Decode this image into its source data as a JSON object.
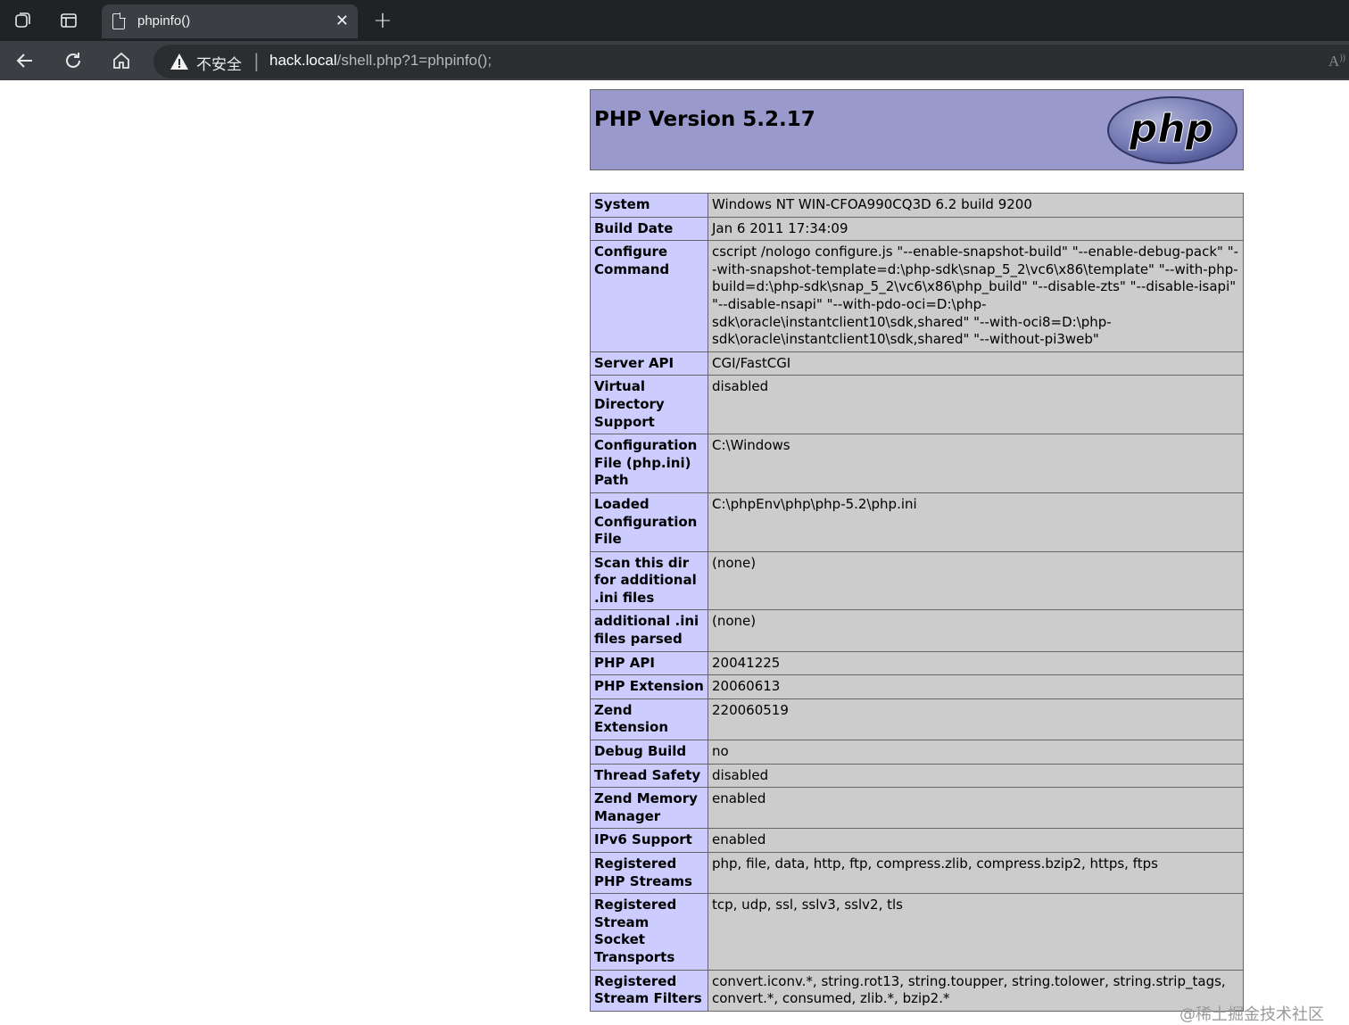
{
  "browser": {
    "tab_title": "phpinfo()",
    "security_label": "不安全",
    "url_host": "hack.local",
    "url_path": "/shell.php?1=phpinfo();",
    "icons": {
      "workspaces": "workspaces-icon",
      "tab_actions": "tab-actions-icon",
      "page": "page-icon",
      "close": "close-icon",
      "new_tab": "plus-icon",
      "back": "back-arrow-icon",
      "refresh": "refresh-icon",
      "home": "home-icon",
      "warning": "warning-icon",
      "read_aloud": "read-aloud-icon"
    }
  },
  "php": {
    "version_title": "PHP Version 5.2.17",
    "logo_text": "php",
    "rows": [
      {
        "key": "System",
        "value": "Windows NT WIN-CFOA990CQ3D 6.2 build 9200"
      },
      {
        "key": "Build Date",
        "value": "Jan 6 2011 17:34:09"
      },
      {
        "key": "Configure Command",
        "value": "cscript /nologo configure.js \"--enable-snapshot-build\" \"--enable-debug-pack\" \"--with-snapshot-template=d:\\php-sdk\\snap_5_2\\vc6\\x86\\template\" \"--with-php-build=d:\\php-sdk\\snap_5_2\\vc6\\x86\\php_build\" \"--disable-zts\" \"--disable-isapi\" \"--disable-nsapi\" \"--with-pdo-oci=D:\\php-sdk\\oracle\\instantclient10\\sdk,shared\" \"--with-oci8=D:\\php-sdk\\oracle\\instantclient10\\sdk,shared\" \"--without-pi3web\""
      },
      {
        "key": "Server API",
        "value": "CGI/FastCGI"
      },
      {
        "key": "Virtual Directory Support",
        "value": "disabled"
      },
      {
        "key": "Configuration File (php.ini) Path",
        "value": "C:\\Windows"
      },
      {
        "key": "Loaded Configuration File",
        "value": "C:\\phpEnv\\php\\php-5.2\\php.ini"
      },
      {
        "key": "Scan this dir for additional .ini files",
        "value": "(none)"
      },
      {
        "key": "additional .ini files parsed",
        "value": "(none)"
      },
      {
        "key": "PHP API",
        "value": "20041225"
      },
      {
        "key": "PHP Extension",
        "value": "20060613"
      },
      {
        "key": "Zend Extension",
        "value": "220060519"
      },
      {
        "key": "Debug Build",
        "value": "no"
      },
      {
        "key": "Thread Safety",
        "value": "disabled"
      },
      {
        "key": "Zend Memory Manager",
        "value": "enabled"
      },
      {
        "key": "IPv6 Support",
        "value": "enabled"
      },
      {
        "key": "Registered PHP Streams",
        "value": "php, file, data, http, ftp, compress.zlib, compress.bzip2, https, ftps"
      },
      {
        "key": "Registered Stream Socket Transports",
        "value": "tcp, udp, ssl, sslv3, sslv2, tls"
      },
      {
        "key": "Registered Stream Filters",
        "value": "convert.iconv.*, string.rot13, string.toupper, string.tolower, string.strip_tags, convert.*, consumed, zlib.*, bzip2.*"
      }
    ]
  },
  "watermark": "@稀土掘金技术社区",
  "colors": {
    "header_bg": "#9999cc",
    "key_bg": "#ccccff",
    "value_bg": "#cccccc",
    "border": "#666666"
  }
}
